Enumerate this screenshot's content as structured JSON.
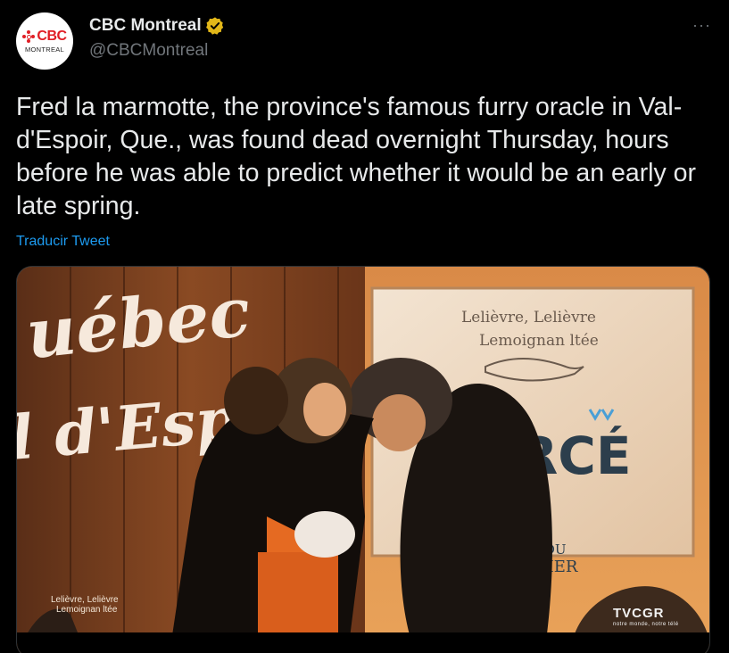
{
  "tweet": {
    "display_name": "CBC Montreal",
    "handle": "@CBCMontreal",
    "verified_icon": "gold-verified-badge-icon",
    "more_label": "···",
    "text": "Fred la marmotte, the province's famous furry oracle in Val-d'Espoir, Que., was found dead overnight Thursday, hours before he was able to predict whether it would be an early or late spring.",
    "translate_label": "Traducir Tweet"
  },
  "avatar": {
    "logo_text": "CBC",
    "logo_sub": "MONTREAL"
  },
  "media": {
    "sign_left_top": "uébec",
    "sign_left_bottom": "l d'Esp",
    "sign_right_line1": "Lelièvre, Lelièvre",
    "sign_right_line2": "Lemoignan ltée",
    "sign_right_big": "ERCÉ",
    "sign_right_small1": "MRC DU",
    "sign_right_small2": "ROCHER",
    "watermark_left_1": "Lelièvre, Lelièvre",
    "watermark_left_2": "Lemoignan ltée",
    "watermark_right": "TVCGR",
    "watermark_right_sub": "notre monde, notre télé"
  },
  "colors": {
    "background": "#000000",
    "text": "#e7e9ea",
    "muted": "#71767b",
    "link": "#1d9bf0",
    "cbc_red": "#e01e25",
    "verified_gold": "#e2b719"
  }
}
